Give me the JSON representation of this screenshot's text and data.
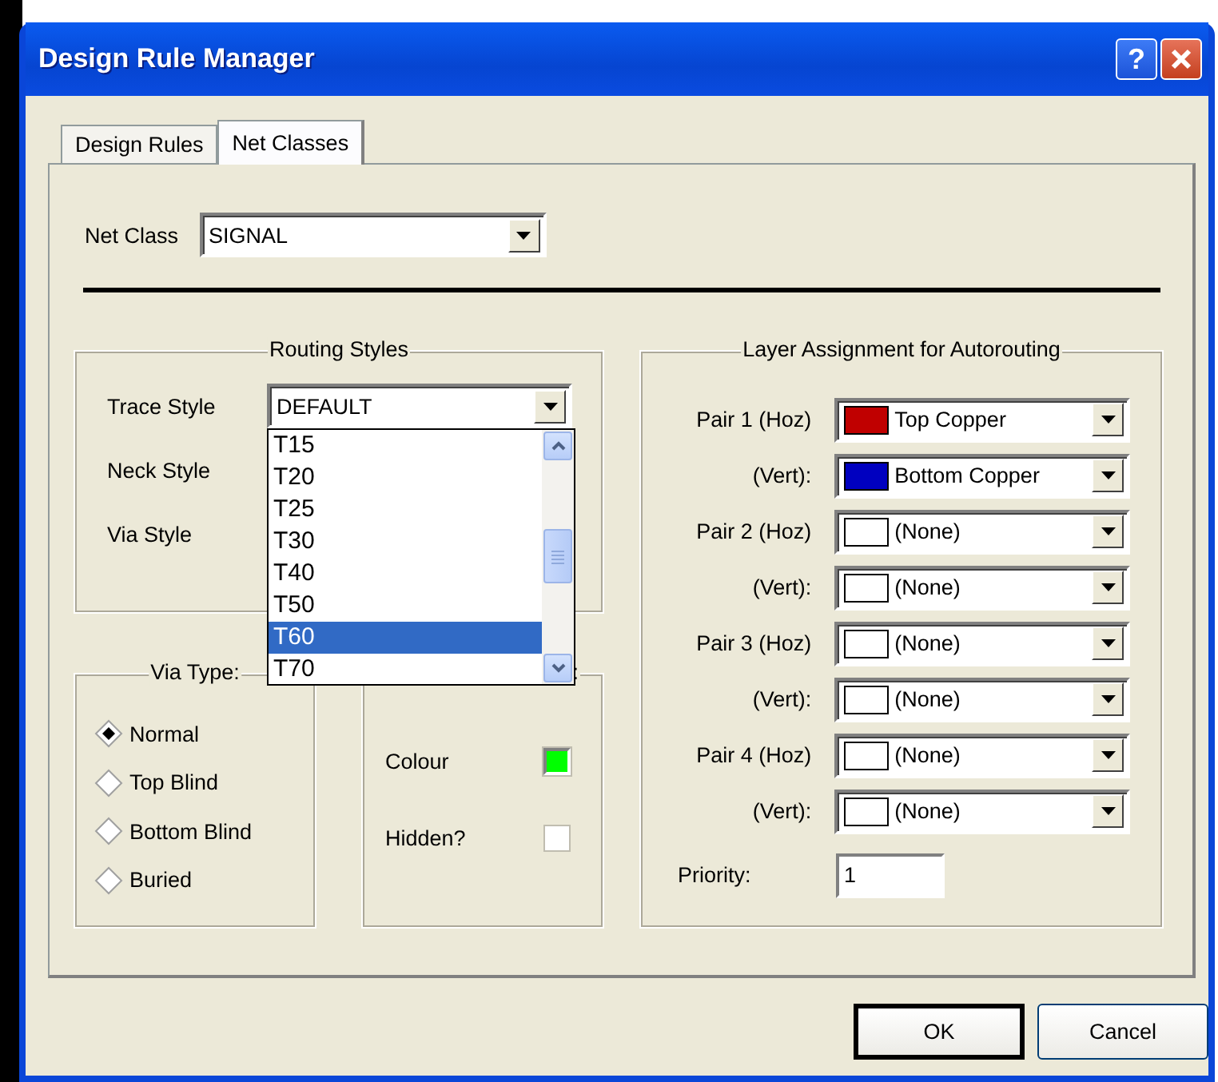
{
  "window": {
    "title": "Design Rule Manager",
    "help_button": "?"
  },
  "tabs": [
    {
      "label": "Design Rules",
      "selected": false
    },
    {
      "label": "Net Classes",
      "selected": true
    }
  ],
  "net_class": {
    "label": "Net Class",
    "value": "SIGNAL"
  },
  "routing_styles": {
    "title": "Routing Styles",
    "fields": [
      {
        "label": "Trace Style",
        "value": "DEFAULT",
        "open": true
      },
      {
        "label": "Neck Style",
        "open": false
      },
      {
        "label": "Via Style",
        "open": false
      }
    ],
    "dropdown_items": [
      {
        "label": "T15",
        "selected": false
      },
      {
        "label": "T20",
        "selected": false
      },
      {
        "label": "T25",
        "selected": false
      },
      {
        "label": "T30",
        "selected": false
      },
      {
        "label": "T40",
        "selected": false
      },
      {
        "label": "T50",
        "selected": false
      },
      {
        "label": "T60",
        "selected": true
      },
      {
        "label": "T70",
        "selected": false
      }
    ]
  },
  "via_type": {
    "title": "Via Type:",
    "options": [
      {
        "label": "Normal",
        "selected": true
      },
      {
        "label": "Top Blind",
        "selected": false
      },
      {
        "label": "Bottom Blind",
        "selected": false
      },
      {
        "label": "Buried",
        "selected": false
      }
    ]
  },
  "attributes": {
    "title": ":",
    "colour": {
      "label": "Colour",
      "color": "#00ff00"
    },
    "hidden": {
      "label": "Hidden?",
      "checked": false
    }
  },
  "layer_assignment": {
    "title": "Layer Assignment for Autorouting",
    "rows": [
      {
        "label": "Pair 1 (Hoz)",
        "layer": "Top Copper",
        "color": "#c00000"
      },
      {
        "label": "(Vert):",
        "layer": "Bottom Copper",
        "color": "#0000c0"
      },
      {
        "label": "Pair 2 (Hoz)",
        "layer": "(None)",
        "color": "#ffffff"
      },
      {
        "label": "(Vert):",
        "layer": "(None)",
        "color": "#ffffff"
      },
      {
        "label": "Pair 3 (Hoz)",
        "layer": "(None)",
        "color": "#ffffff"
      },
      {
        "label": "(Vert):",
        "layer": "(None)",
        "color": "#ffffff"
      },
      {
        "label": "Pair 4 (Hoz)",
        "layer": "(None)",
        "color": "#ffffff"
      },
      {
        "label": "(Vert):",
        "layer": "(None)",
        "color": "#ffffff"
      }
    ],
    "priority": {
      "label": "Priority:",
      "value": "1"
    }
  },
  "buttons": [
    {
      "label": "OK",
      "default": true
    },
    {
      "label": "Cancel",
      "default": false
    }
  ]
}
